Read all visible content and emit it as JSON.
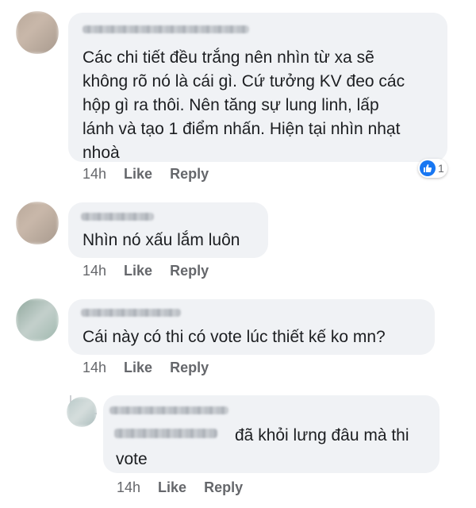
{
  "comments": [
    {
      "text": "Các chi tiết đều trắng nên nhìn từ xa sẽ\nkhông rõ nó là cái gì. Cứ tưởng KV đeo các\nhộp gì ra thôi. Nên tăng sự lung linh, lấp\nlánh và tạo 1 điểm nhấn. Hiện tại nhìn nhạt\nnhoà",
      "time": "14h",
      "like": "Like",
      "reply": "Reply",
      "reaction_count": "1"
    },
    {
      "text": "Nhìn nó xấu lắm luôn",
      "time": "14h",
      "like": "Like",
      "reply": "Reply"
    },
    {
      "text": "Cái này có thi có vote lúc thiết kế ko mn?",
      "time": "14h",
      "like": "Like",
      "reply": "Reply"
    },
    {
      "text": "đã khỏi lưng đâu mà thi\nvote",
      "time": "14h",
      "like": "Like",
      "reply": "Reply"
    }
  ],
  "icons": {
    "reaction": "like-icon",
    "avatar": "avatar"
  },
  "colors": {
    "bubble": "#f0f2f5",
    "meta": "#65676b",
    "like_blue": "#1877f2"
  }
}
